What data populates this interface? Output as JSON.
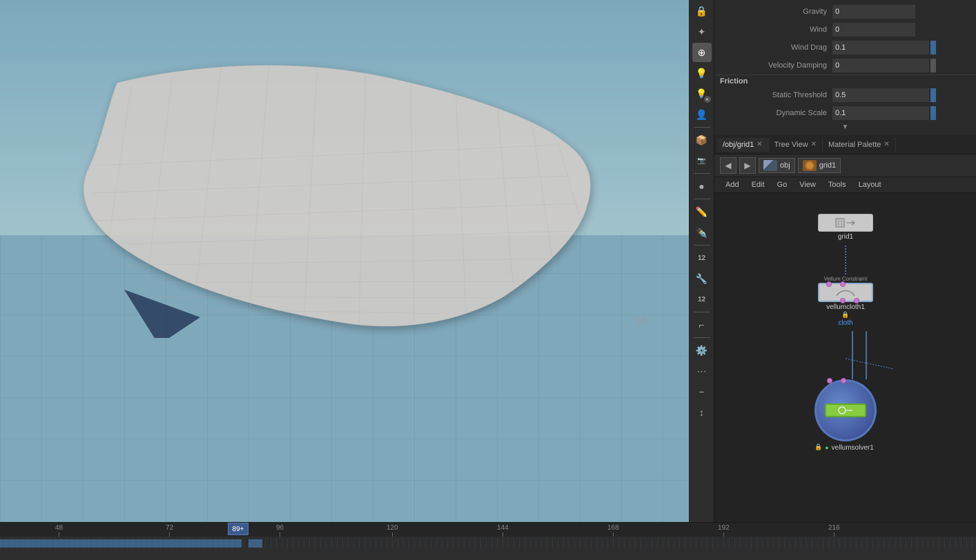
{
  "properties": {
    "gravity_label": "Gravity",
    "gravity_value": "0",
    "wind_label": "Wind",
    "wind_value": "0",
    "wind_drag_label": "Wind Drag",
    "wind_drag_value": "0.1",
    "velocity_damping_label": "Velocity Damping",
    "velocity_damping_value": "0",
    "friction_label": "Friction",
    "static_threshold_label": "Static Threshold",
    "static_threshold_value": "0.5",
    "dynamic_scale_label": "Dynamic Scale",
    "dynamic_scale_value": "0.1"
  },
  "tabs": [
    {
      "label": "/obj/grid1",
      "active": true
    },
    {
      "label": "Tree View",
      "active": false
    },
    {
      "label": "Material Palette",
      "active": false
    }
  ],
  "nav": {
    "back": "◀",
    "forward": "▶",
    "path1": "obj",
    "path2": "grid1"
  },
  "menu": {
    "items": [
      "Add",
      "Edit",
      "Go",
      "View",
      "Tools",
      "Layout"
    ]
  },
  "nodes": {
    "grid1": {
      "label": "grid1"
    },
    "vellumcloth1": {
      "label": "vellumcloth1",
      "type": "Vellum Constraint"
    },
    "cloth": {
      "label": "cloth"
    },
    "vellumsolver1": {
      "label": "vellumsolver1"
    }
  },
  "timeline": {
    "ticks": [
      48,
      72,
      96,
      120,
      144,
      168,
      192,
      216
    ],
    "playhead": "89",
    "playhead_suffix": "+"
  },
  "toolbar": {
    "icons": [
      "🔒",
      "✦",
      "💡",
      "🎯",
      "💡",
      "👤",
      "📦",
      "✏️",
      "✒️",
      "🔧",
      "🗜️",
      "📐",
      "⚙️",
      "✦",
      "☰"
    ]
  }
}
